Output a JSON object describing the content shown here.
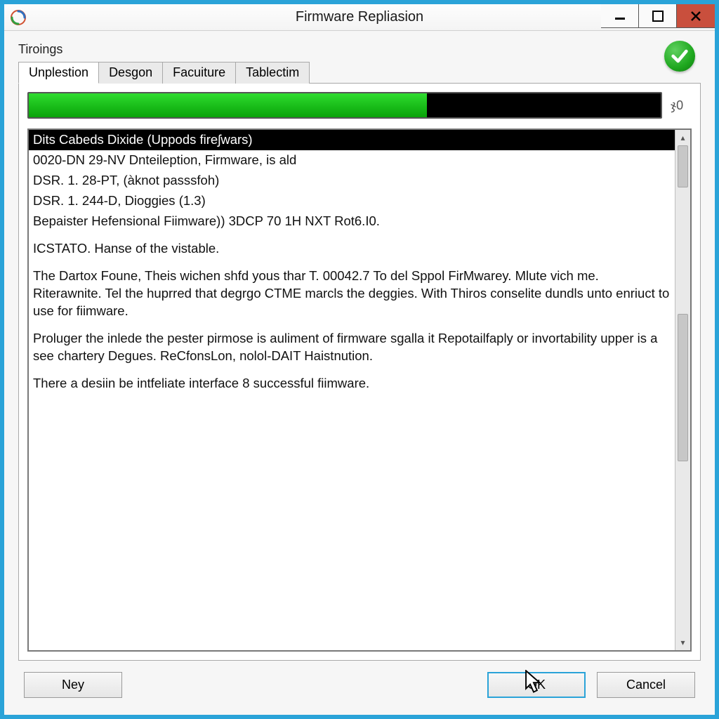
{
  "window": {
    "title": "Firmware Repliasion"
  },
  "section_label": "Tiroings",
  "tabs": [
    {
      "label": "Unplestion",
      "active": true
    },
    {
      "label": "Desgon",
      "active": false
    },
    {
      "label": "Facuiture",
      "active": false
    },
    {
      "label": "Tablectim",
      "active": false
    }
  ],
  "progress": {
    "percent": 63,
    "label": "ჯ0"
  },
  "log": {
    "header": "Dits Cabeds Dixide (Uppods fireʃwars)",
    "lines": [
      "0020-DN 29-NV Dnteileption, Firmware, is ald",
      "DSR. 1. 28-PT, (àknot passsfoh)",
      "DSR. 1. 244-D, Dioggies (1.3)",
      "Bepaister Hefensional Fiimware)) 3DCP 70 1H NXT Rot6.I0."
    ],
    "sections": [
      "ICSTATO. Hanse of the vistable.",
      "The Dartox Foune, Theis wichen shfd yous thar T. 00042.7 To del Sppol FirMwarey. Mlute vich me. Riterawnite. Tel the huprred that degrgo CTME marcls the deggies. With Thiros conselite dundls unto enriuct to use for fiimware.",
      "Proluger the inlede the pester pirmose is auliment of firmware sgalla it Repotailfaply or invortability upper is a see chartery Degues. ReCfonsLon, nolol-DAIT Haistnution.",
      "There a desiin be intfeliate interface 8 successful fiimware."
    ]
  },
  "buttons": {
    "ney": "Ney",
    "ok": "OK",
    "cancel": "Cancel"
  }
}
